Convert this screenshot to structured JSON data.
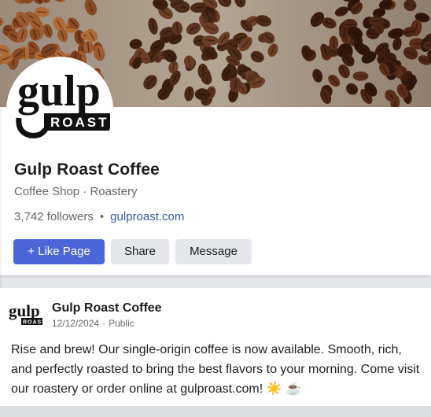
{
  "cover": {
    "icon": "coffee-beans-photo"
  },
  "profile": {
    "logo_text_top": "gulp",
    "logo_text_bottom": "ROAST",
    "name": "Gulp Roast Coffee",
    "category": "Coffee Shop · Roastery",
    "followers": "3,742 followers",
    "separator": "•",
    "website": "gulproast.com"
  },
  "actions": {
    "like_label": "+ Like Page",
    "share_label": "Share",
    "message_label": "Message"
  },
  "post": {
    "author": "Gulp Roast Coffee",
    "date": "12/12/2024",
    "separator": "·",
    "visibility": "Public",
    "text": "Rise and brew! Our single-origin coffee is now available. Smooth, rich, and perfectly roasted to bring the best flavors to your morning. Come visit our roastery or order online at gulproast.com! ☀️ ☕"
  },
  "colors": {
    "primary_button": "#4a66d9",
    "secondary_button": "#e4e6e9",
    "link": "#385898",
    "muted_text": "#65676b"
  }
}
